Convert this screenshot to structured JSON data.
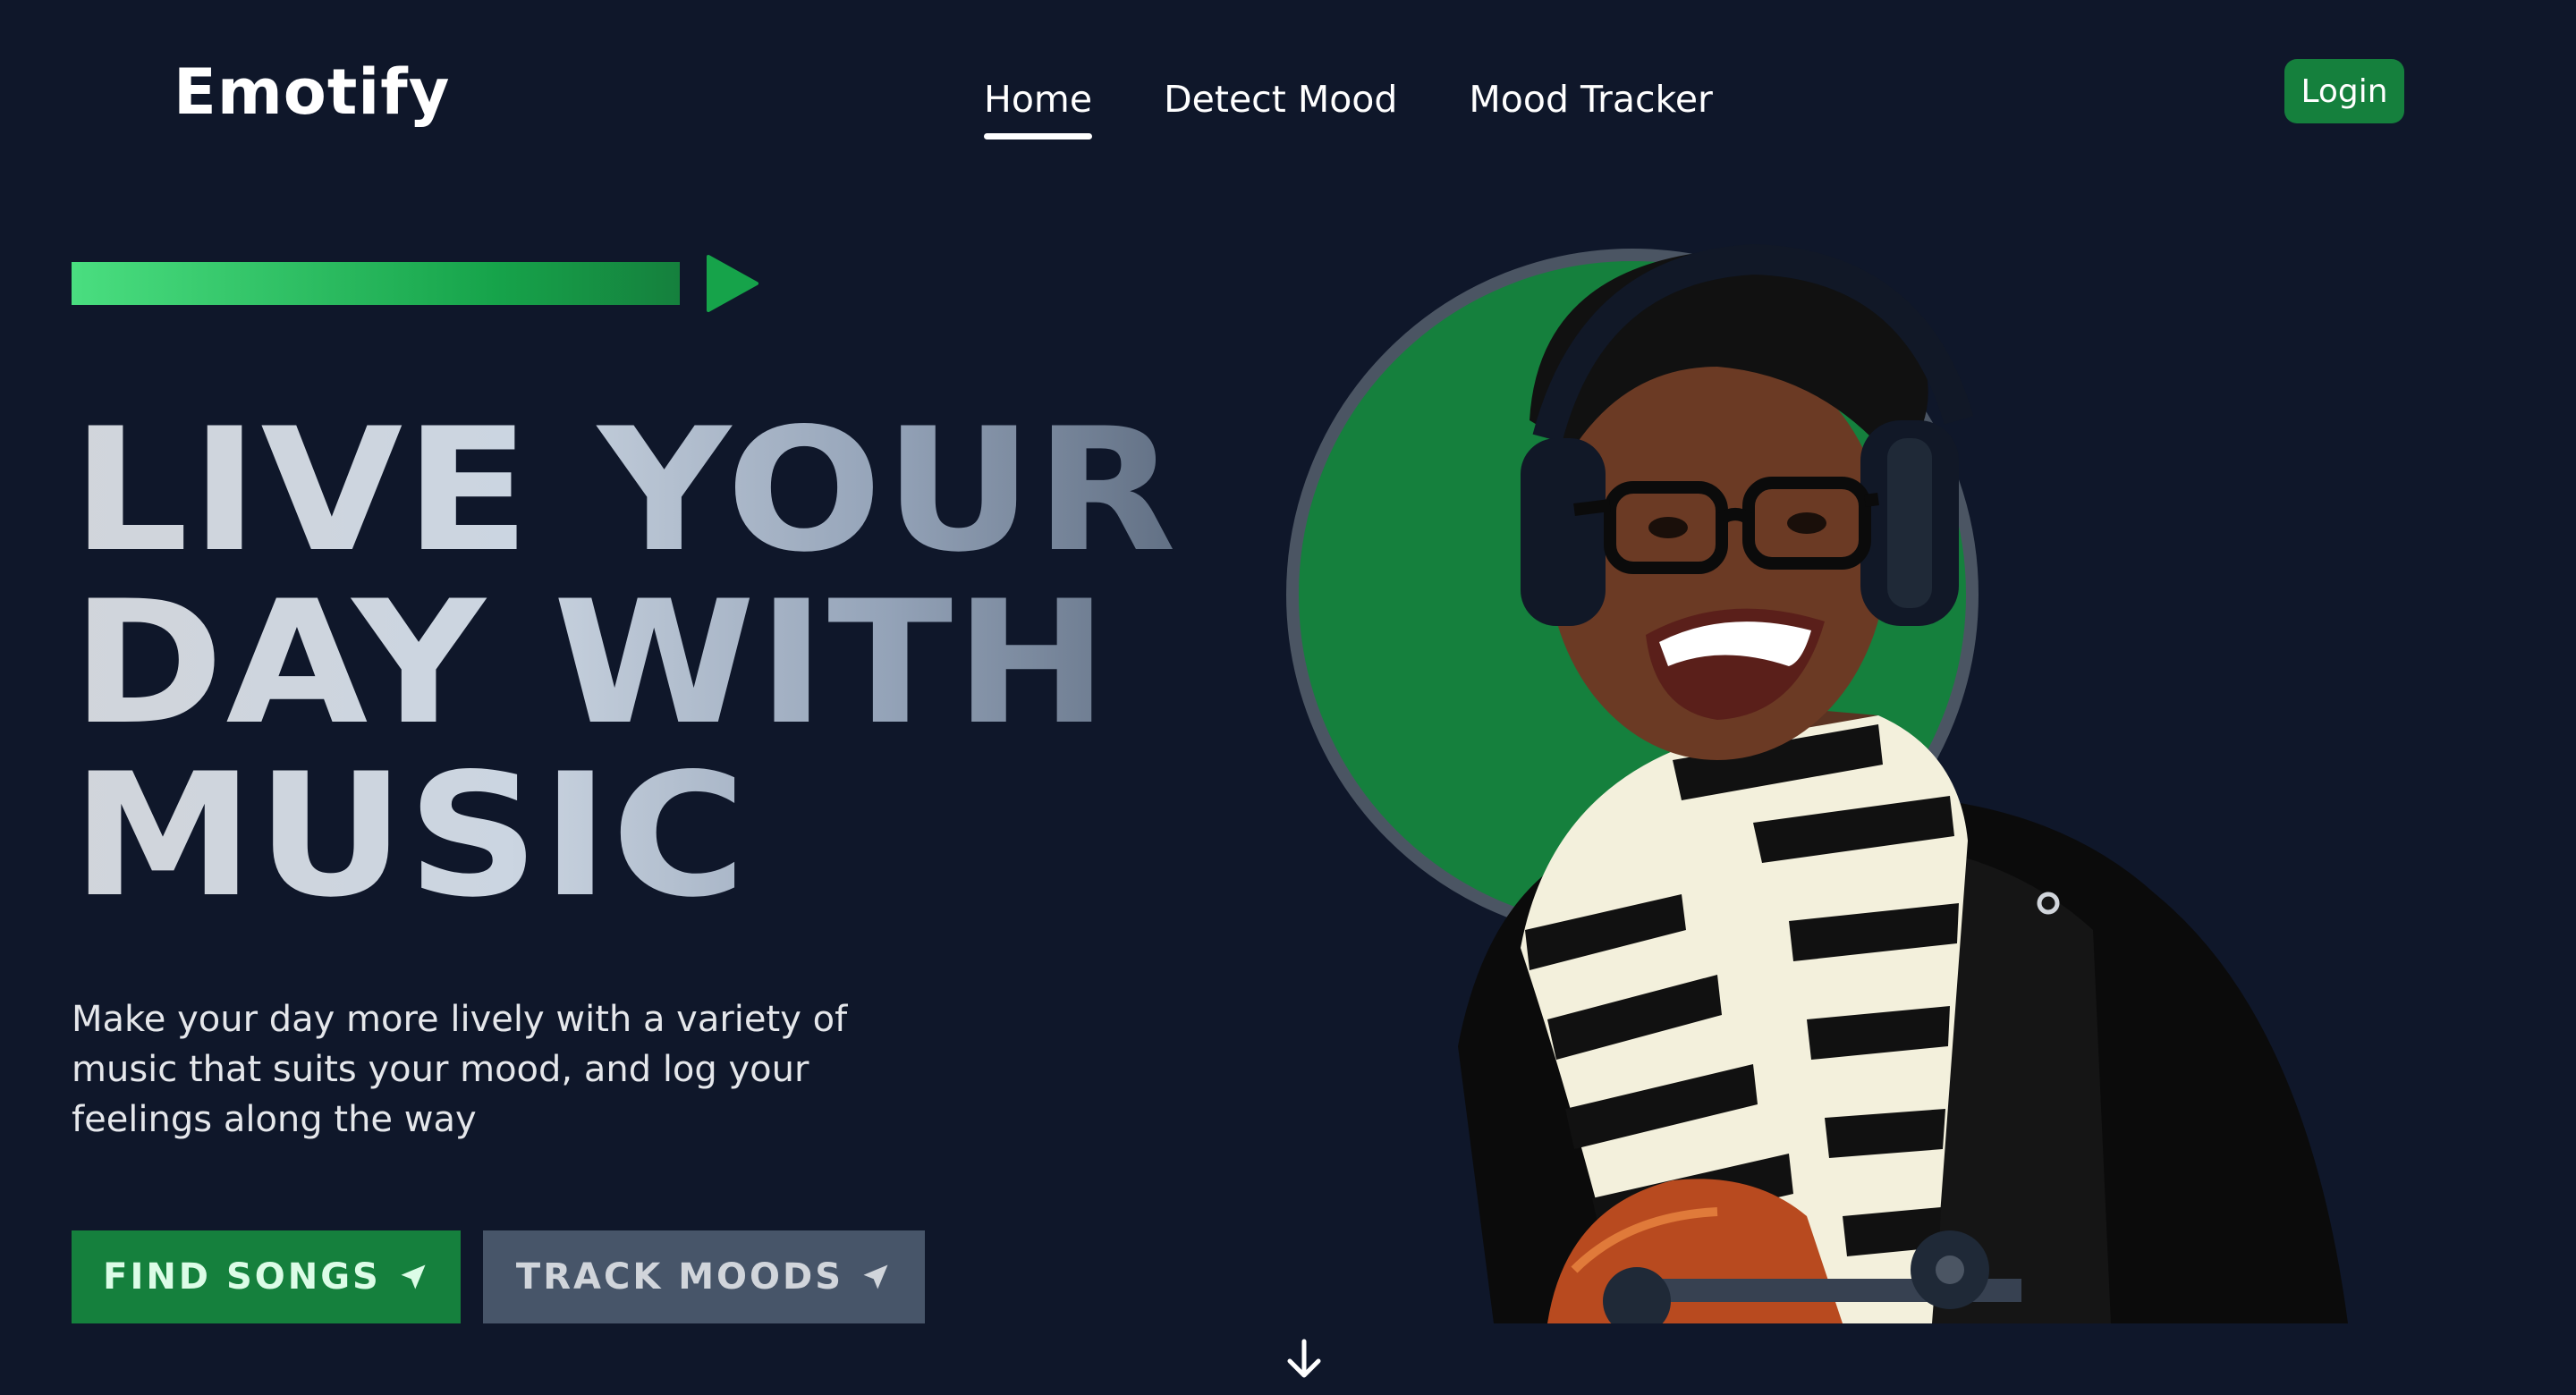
{
  "brand": {
    "name": "Emotify"
  },
  "nav": {
    "items": [
      {
        "label": "Home",
        "active": true
      },
      {
        "label": "Detect Mood",
        "active": false
      },
      {
        "label": "Mood Tracker",
        "active": false
      }
    ],
    "login_label": "Login"
  },
  "hero": {
    "title_lines": [
      "LIVE YOUR",
      "DAY WITH",
      "MUSIC"
    ],
    "subtitle": "Make your day more lively with a variety of music that suits your mood, and log your feelings along the way",
    "buttons": {
      "find_songs": "FIND SONGS",
      "track_moods": "TRACK MOODS"
    }
  },
  "colors": {
    "background": "#0f172a",
    "accent_green": "#15803d",
    "accent_green_light": "#4ade80",
    "secondary_button": "#475569",
    "circle_ring": "#4b5563"
  },
  "icons": {
    "play": "play-icon",
    "send": "send-arrow-icon",
    "scroll": "arrow-down-icon"
  }
}
